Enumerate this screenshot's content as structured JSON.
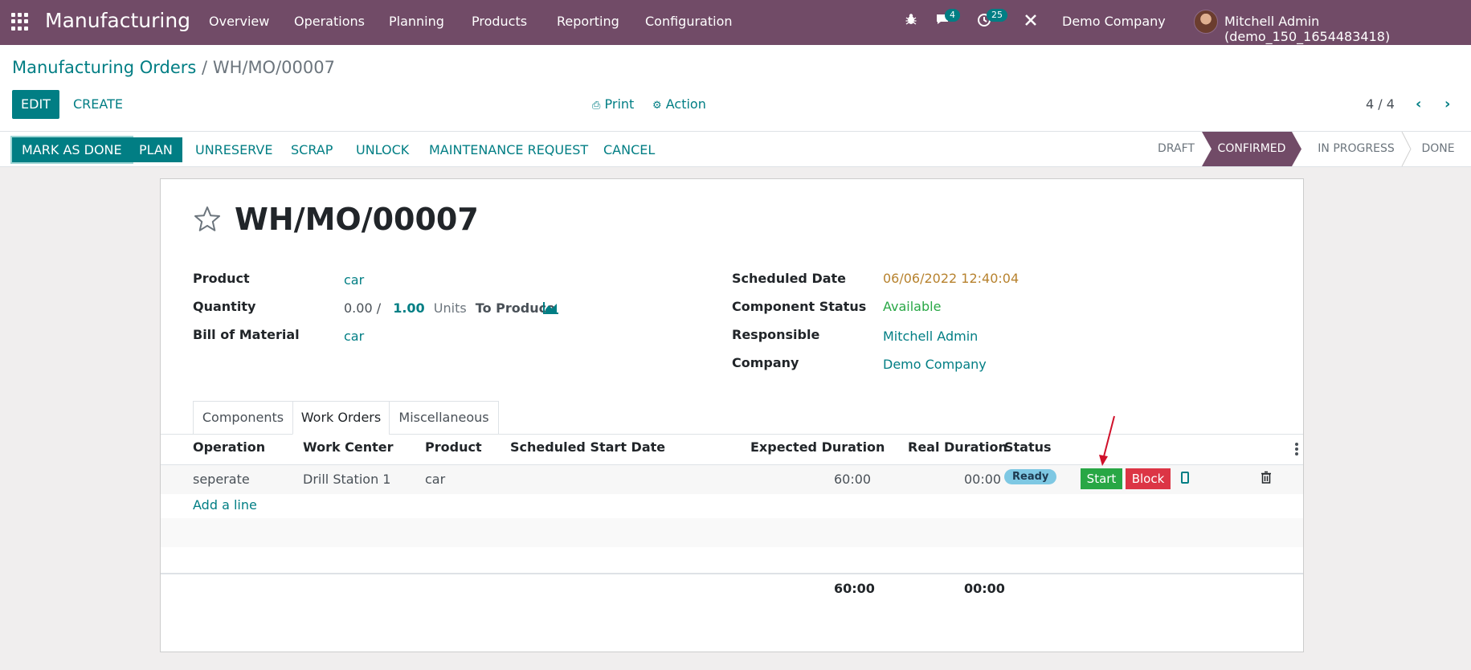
{
  "navbar": {
    "brand": "Manufacturing",
    "menu": [
      "Overview",
      "Operations",
      "Planning",
      "Products",
      "Reporting",
      "Configuration"
    ],
    "messages_count": "4",
    "activities_count": "25",
    "company": "Demo Company",
    "user": "Mitchell Admin (demo_150_1654483418)"
  },
  "control": {
    "breadcrumb_parent": "Manufacturing Orders",
    "breadcrumb_sep": "/",
    "breadcrumb_current": "WH/MO/00007",
    "edit_label": "EDIT",
    "create_label": "CREATE",
    "print_label": "Print",
    "action_label": "Action",
    "pager": "4 / 4"
  },
  "statusbar": {
    "buttons": [
      "MARK AS DONE",
      "PLAN",
      "UNRESERVE",
      "SCRAP",
      "UNLOCK",
      "MAINTENANCE REQUEST",
      "CANCEL"
    ],
    "stages": [
      "DRAFT",
      "CONFIRMED",
      "IN PROGRESS",
      "DONE"
    ],
    "active_stage": "CONFIRMED"
  },
  "form": {
    "title": "WH/MO/00007",
    "left": {
      "product_label": "Product",
      "product_value": "car",
      "quantity_label": "Quantity",
      "quantity_done": "0.00",
      "quantity_sep": "/",
      "quantity_total": "1.00",
      "quantity_units": "Units",
      "quantity_suffix": "To Produce",
      "bom_label": "Bill of Material",
      "bom_value": "car"
    },
    "right": {
      "scheduled_label": "Scheduled Date",
      "scheduled_value": "06/06/2022 12:40:04",
      "component_label": "Component Status",
      "component_value": "Available",
      "responsible_label": "Responsible",
      "responsible_value": "Mitchell Admin",
      "company_label": "Company",
      "company_value": "Demo Company"
    },
    "tabs": [
      "Components",
      "Work Orders",
      "Miscellaneous"
    ],
    "active_tab": "Work Orders"
  },
  "workorders": {
    "columns": [
      "Operation",
      "Work Center",
      "Product",
      "Scheduled Start Date",
      "Expected Duration",
      "Real Duration",
      "Status"
    ],
    "rows": [
      {
        "operation": "seperate",
        "work_center": "Drill Station 1",
        "product": "car",
        "scheduled_start": "",
        "expected": "60:00",
        "real": "00:00",
        "status": "Ready",
        "start_label": "Start",
        "block_label": "Block"
      }
    ],
    "add_line": "Add a line",
    "total_expected": "60:00",
    "total_real": "00:00"
  },
  "colors": {
    "brand": "#714B67",
    "accent": "#017e84",
    "success": "#28a745",
    "danger": "#dc3545",
    "warning": "#b7822e"
  }
}
